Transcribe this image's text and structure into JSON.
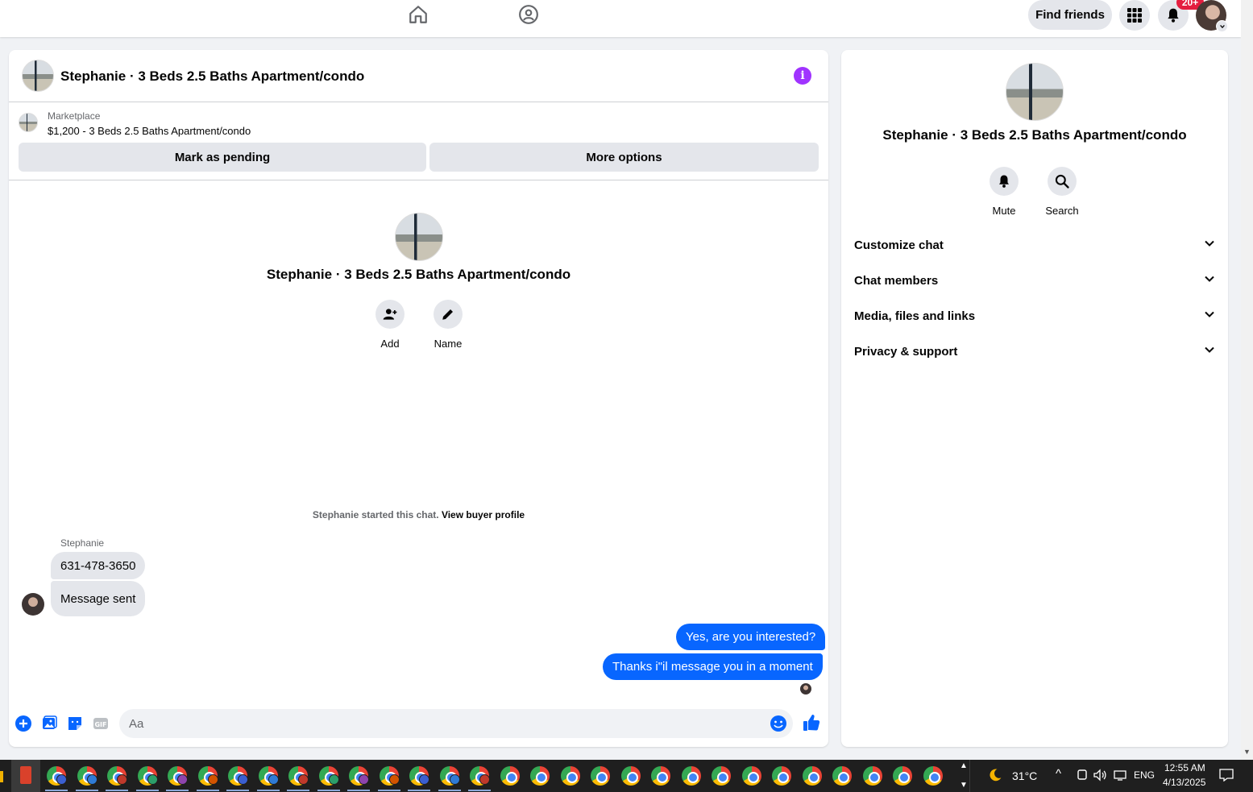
{
  "topbar": {
    "find_friends_label": "Find friends",
    "notification_count": "20+"
  },
  "chat": {
    "title": "Stephanie · 3 Beds 2.5 Baths Apartment/condo",
    "marketplace_label": "Marketplace",
    "marketplace_item": "$1,200 - 3 Beds 2.5 Baths Apartment/condo",
    "mark_pending_label": "Mark as pending",
    "more_options_label": "More options",
    "center_name": "Stephanie · 3 Beds 2.5 Baths Apartment/condo",
    "actions": [
      {
        "label": "Add",
        "icon": "add-person-icon"
      },
      {
        "label": "Name",
        "icon": "pencil-icon"
      }
    ],
    "started_text": "Stephanie started this chat.",
    "view_buyer_profile": "View buyer profile",
    "sender_name": "Stephanie",
    "messages_in": [
      "631-478-3650",
      "Message sent"
    ],
    "messages_out": [
      "Yes, are you interested?",
      "Thanks i\"il message you in a moment"
    ],
    "composer_placeholder": "Aa"
  },
  "side": {
    "name": "Stephanie · 3 Beds 2.5 Baths Apartment/condo",
    "actions": [
      {
        "label": "Mute",
        "icon": "bell-icon"
      },
      {
        "label": "Search",
        "icon": "search-icon"
      }
    ],
    "sections": [
      "Customize chat",
      "Chat members",
      "Media, files and links",
      "Privacy & support"
    ]
  },
  "taskbar": {
    "temperature": "31°C",
    "language": "ENG",
    "time": "12:55 AM",
    "date": "4/13/2025"
  },
  "colors": {
    "accent": "#0866ff",
    "info": "#a033ff",
    "badge": "#e41e3f"
  }
}
